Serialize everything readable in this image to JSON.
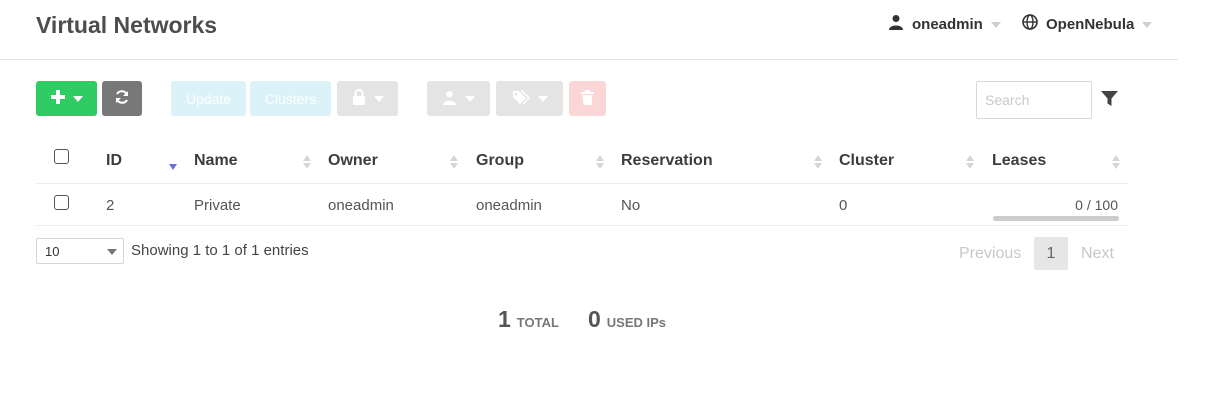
{
  "header": {
    "title": "Virtual Networks",
    "user": {
      "name": "oneadmin",
      "icon": "user-icon"
    },
    "zone": {
      "name": "OpenNebula",
      "icon": "globe-icon"
    }
  },
  "toolbar": {
    "create_icon": "plus-icon",
    "refresh_icon": "refresh-icon",
    "update_label": "Update",
    "clusters_label": "Clusters",
    "lock_icon": "lock-icon",
    "owner_icon": "user-icon",
    "labels_icon": "tags-icon",
    "delete_icon": "trash-icon"
  },
  "search": {
    "placeholder": "Search",
    "value": ""
  },
  "table": {
    "columns": [
      "ID",
      "Name",
      "Owner",
      "Group",
      "Reservation",
      "Cluster",
      "Leases"
    ],
    "rows": [
      {
        "id": "2",
        "name": "Private",
        "owner": "oneadmin",
        "group": "oneadmin",
        "reservation": "No",
        "cluster": "0",
        "leases": "0 / 100",
        "leases_fraction": 0
      }
    ]
  },
  "pagination": {
    "length": "10",
    "info": "Showing 1 to 1 of 1 entries",
    "previous": "Previous",
    "current": "1",
    "next": "Next"
  },
  "totals": {
    "total_count": "1",
    "total_label": "TOTAL",
    "used_count": "0",
    "used_label": "USED IPs"
  },
  "colors": {
    "create": "#2ecc62",
    "refresh": "#787878",
    "update": "#daf2f8",
    "disabled": "#e4e4e4",
    "delete": "#fbd6d6"
  }
}
